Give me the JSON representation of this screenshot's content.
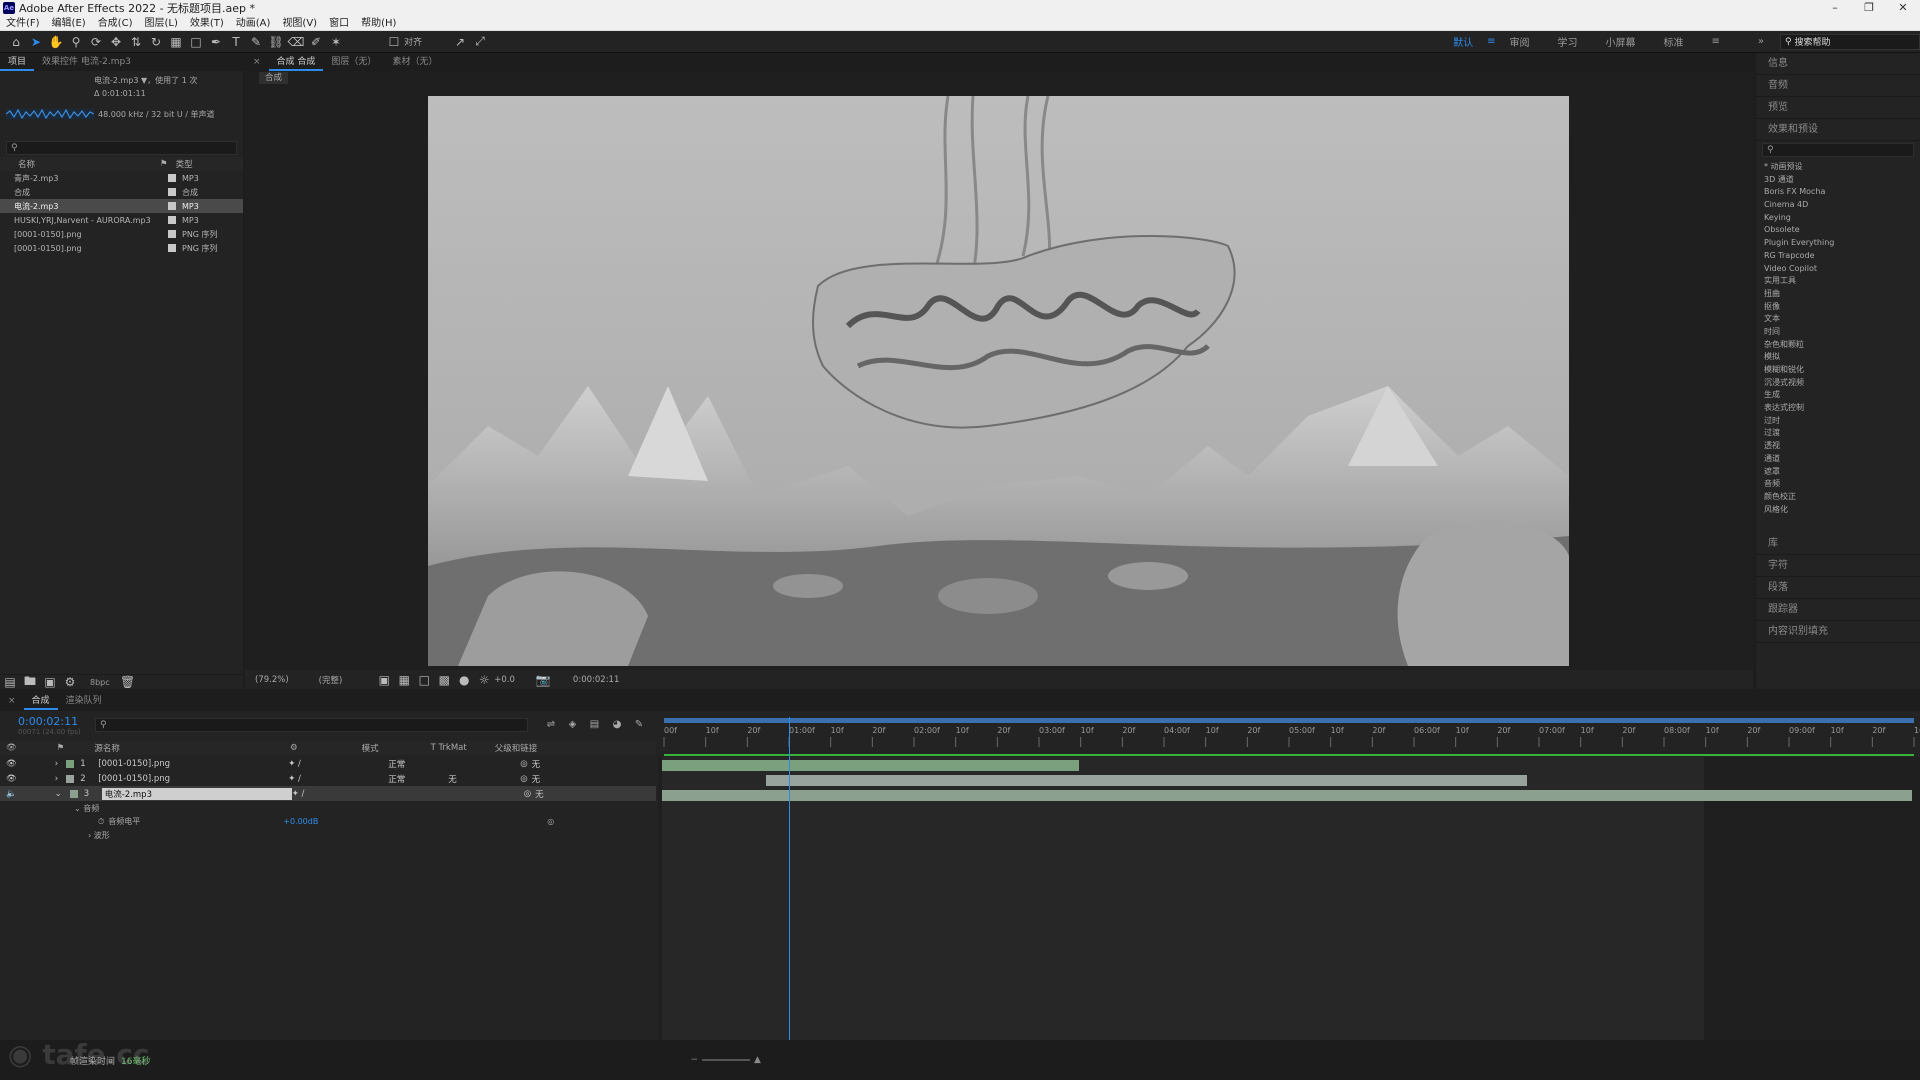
{
  "titlebar": {
    "title": "Adobe After Effects 2022 - 无标题项目.aep *",
    "logo": "Ae"
  },
  "menu": [
    "文件(F)",
    "编辑(E)",
    "合成(C)",
    "图层(L)",
    "效果(T)",
    "动画(A)",
    "视图(V)",
    "窗口",
    "帮助(H)"
  ],
  "toolbar": {
    "align_label": "对齐",
    "workspaces": [
      "默认",
      "审阅",
      "学习",
      "小屏幕",
      "标准"
    ],
    "active_workspace": "默认",
    "help_search_placeholder": "搜索帮助"
  },
  "project": {
    "tab_label": "项目",
    "effects_tab_label": "效果控件 电流-2.mp3",
    "preview_name": "电流-2.mp3 ▼，使用了 1 次",
    "preview_duration": "Δ 0:01:01:11",
    "preview_audio": "48.000 kHz / 32 bit U / 单声道",
    "columns": {
      "name": "名称",
      "type": "类型"
    },
    "items": [
      {
        "name": "青声-2.mp3",
        "type": "MP3",
        "color": "#c8c8c8",
        "selected": false
      },
      {
        "name": "合成",
        "type": "合成",
        "color": "#c8c8c8",
        "selected": false
      },
      {
        "name": "电流-2.mp3",
        "type": "MP3",
        "color": "#c8c8c8",
        "selected": true
      },
      {
        "name": "HUSKI,YRJ,Narvent - AURORA.mp3",
        "type": "MP3",
        "color": "#c8c8c8",
        "selected": false
      },
      {
        "name": "[0001-0150].png",
        "type": "PNG 序列",
        "color": "#c8c8c8",
        "selected": false
      },
      {
        "name": "[0001-0150].png",
        "type": "PNG 序列",
        "color": "#c8c8c8",
        "selected": false
      }
    ],
    "bpc": "8bpc"
  },
  "viewer": {
    "tabs": [
      "合成 合成",
      "图层（无）",
      "素材（无）"
    ],
    "breadcrumb": "合成",
    "zoom": "(79.2%)",
    "resolution": "(完整)",
    "exposure": "+0.0",
    "timecode": "0:00:02:11"
  },
  "right_panel": {
    "sections_top": [
      "信息",
      "音频",
      "预览"
    ],
    "effects_title": "效果和预设",
    "effects": [
      "* 动画预设",
      "3D 通道",
      "Boris FX Mocha",
      "Cinema 4D",
      "Keying",
      "Obsolete",
      "Plugin Everything",
      "RG Trapcode",
      "Video Copilot",
      "实用工具",
      "扭曲",
      "抠像",
      "文本",
      "时间",
      "杂色和颗粒",
      "模拟",
      "模糊和锐化",
      "沉浸式视频",
      "生成",
      "表达式控制",
      "过时",
      "过渡",
      "透视",
      "通道",
      "遮罩",
      "音频",
      "颜色校正",
      "风格化"
    ],
    "sections_bottom": [
      "库",
      "字符",
      "段落",
      "跟踪器",
      "内容识别填充"
    ]
  },
  "timeline": {
    "tabs": [
      "合成",
      "渲染队列"
    ],
    "current_time": "0:00:02:11",
    "frame_info": "00071 (24.00 fps)",
    "headers": {
      "name": "源名称",
      "mode": "模式",
      "trkmat": "T TrkMat",
      "parent": "父级和链接"
    },
    "ruler_labels": [
      "00f",
      "10f",
      "20f",
      "01:00f",
      "10f",
      "20f",
      "02:00f",
      "10f",
      "20f",
      "03:00f",
      "10f",
      "20f",
      "04:00f",
      "10f",
      "20f",
      "05:00f",
      "10f",
      "20f",
      "06:00f",
      "10f",
      "20f",
      "07:00f",
      "10f",
      "20f",
      "08:00f",
      "10f",
      "20f",
      "09:00f",
      "10f",
      "20f",
      "10:0"
    ],
    "playhead_fraction": 0.1,
    "layers": [
      {
        "num": "1",
        "name": "[0001-0150].png",
        "mode": "正常",
        "trkmat": "",
        "parent": "无",
        "start": 0.0,
        "end": 0.4,
        "color": "#7aa07d"
      },
      {
        "num": "2",
        "name": "[0001-0150].png",
        "mode": "正常",
        "trkmat": "无",
        "parent": "无",
        "start": 0.1,
        "end": 0.83,
        "color": "#98a39d"
      },
      {
        "num": "3",
        "name": "电流-2.mp3",
        "mode": "",
        "trkmat": "",
        "parent": "无",
        "start": 0.0,
        "end": 1.0,
        "color": "#8ca08f"
      }
    ],
    "sub_group": "音频",
    "sub_property": "音频电平",
    "sub_value": "+0.00dB",
    "sub_waveform": "波形",
    "footer_label": "帧渲染时间",
    "footer_value": "16毫秒"
  },
  "watermark": "tafe.cc"
}
